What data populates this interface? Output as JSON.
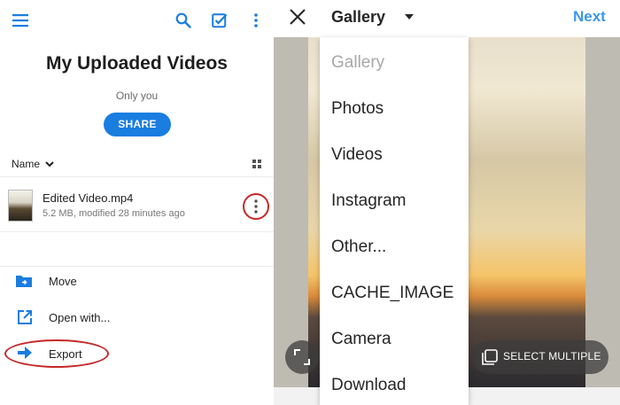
{
  "left_app": {
    "folder_title": "My Uploaded Videos",
    "folder_subtitle": "Only you",
    "share_label": "SHARE",
    "sort_label": "Name",
    "file": {
      "name": "Edited Video.mp4",
      "meta": "5.2 MB, modified 28 minutes ago"
    },
    "actions": [
      {
        "label": "Move",
        "icon": "folder-move-icon"
      },
      {
        "label": "Open with...",
        "icon": "open-external-icon"
      },
      {
        "label": "Export",
        "icon": "arrow-right-icon"
      }
    ],
    "accent_color": "#1a7de0",
    "highlight_color": "#c62828"
  },
  "right_app": {
    "title": "Gallery",
    "next_label": "Next",
    "menu_items": [
      "Gallery",
      "Photos",
      "Videos",
      "Instagram",
      "Other...",
      "CACHE_IMAGE",
      "Camera",
      "Download"
    ],
    "select_multiple_label": "SELECT MULTIPLE",
    "accent_color": "#3897f0"
  }
}
